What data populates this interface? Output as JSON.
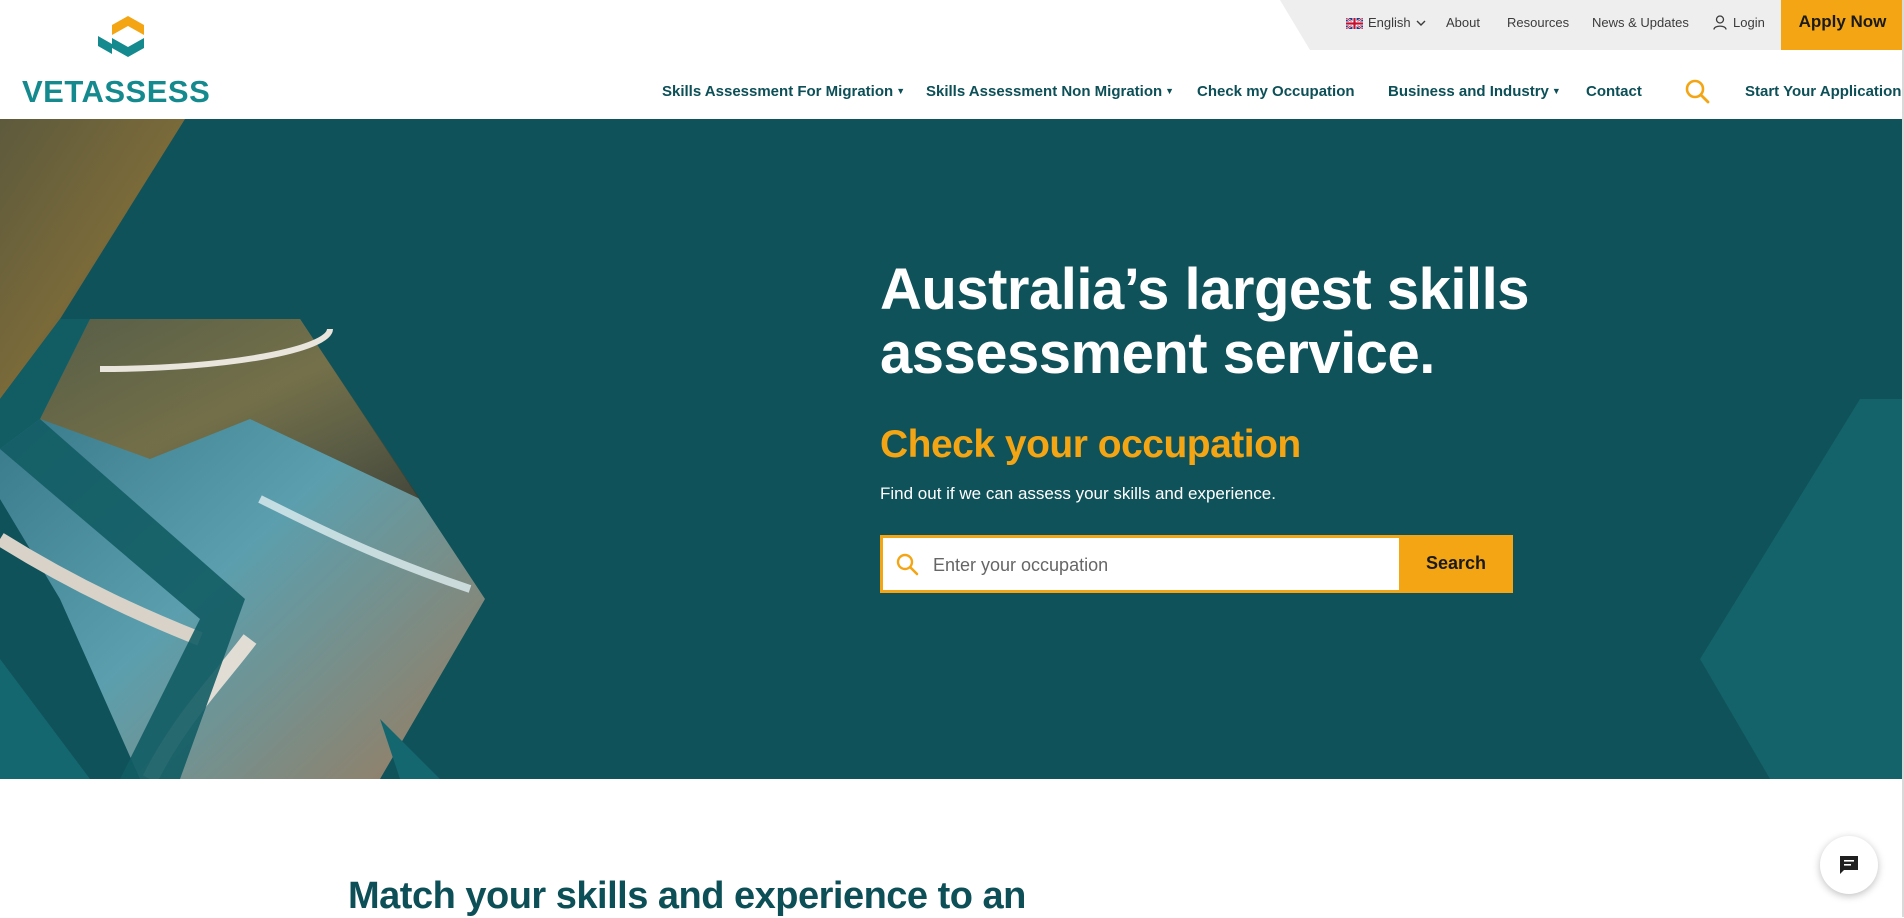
{
  "brand": {
    "name": "VETASSESS",
    "colors": {
      "teal_dark": "#0f525a",
      "teal": "#148a8f",
      "orange": "#f4a514"
    }
  },
  "utility_nav": {
    "language": "English",
    "items": [
      "About",
      "Resources",
      "News & Updates"
    ],
    "login": "Login",
    "apply_now": "Apply Now"
  },
  "main_nav": {
    "items": [
      "Skills Assessment For Migration",
      "Skills Assessment Non Migration",
      "Check my Occupation",
      "Business and Industry",
      "Contact"
    ],
    "start_application": "Start Your Application"
  },
  "hero": {
    "title": "Australia’s largest skills assessment service.",
    "subtitle": "Check your occupation",
    "description": "Find out if we can assess your skills and experience.",
    "search_placeholder": "Enter your occupation",
    "search_button": "Search"
  },
  "section": {
    "heading": "Match your skills and experience to an"
  },
  "icons": {
    "language_flag": "uk-flag-icon",
    "language_dropdown": "chevron-down-icon",
    "login": "user-icon",
    "nav_search": "search-icon",
    "field_search": "search-icon",
    "chat": "chat-bubble-icon"
  }
}
